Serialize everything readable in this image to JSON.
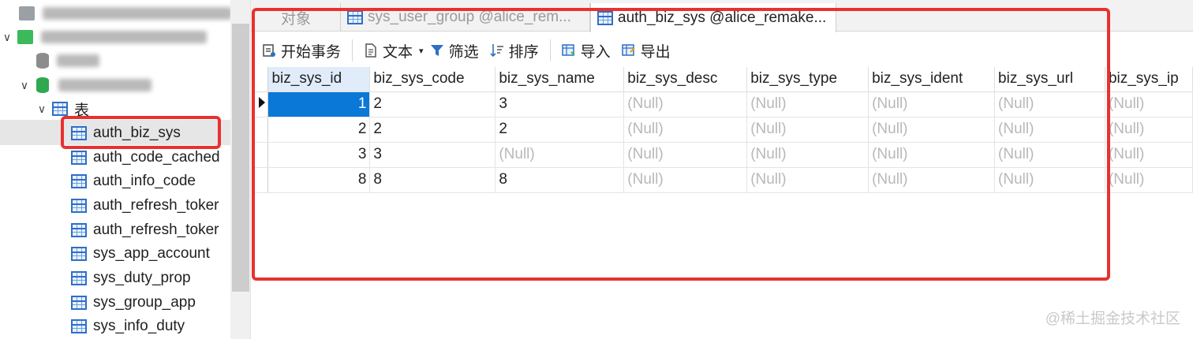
{
  "sidebar": {
    "tree": {
      "category_label": "表",
      "tables": [
        "auth_biz_sys",
        "auth_code_cached",
        "auth_info_code",
        "auth_refresh_toker",
        "auth_refresh_toker",
        "sys_app_account",
        "sys_duty_prop",
        "sys_group_app",
        "sys_info_duty"
      ],
      "selected_table": "auth_biz_sys"
    }
  },
  "tabs": [
    {
      "label": "对象",
      "active": false
    },
    {
      "label": "sys_user_group @alice_rem...",
      "active": false
    },
    {
      "label": "auth_biz_sys @alice_remake...",
      "active": true
    }
  ],
  "toolbar": {
    "begin_transaction": "开始事务",
    "text": "文本",
    "filter": "筛选",
    "sort": "排序",
    "import": "导入",
    "export": "导出"
  },
  "grid": {
    "columns": [
      "biz_sys_id",
      "biz_sys_code",
      "biz_sys_name",
      "biz_sys_desc",
      "biz_sys_type",
      "biz_sys_ident",
      "biz_sys_url",
      "biz_sys_ip"
    ],
    "rows": [
      [
        "1",
        "2",
        "3",
        "(Null)",
        "(Null)",
        "(Null)",
        "(Null)",
        "(Null)"
      ],
      [
        "2",
        "2",
        "2",
        "(Null)",
        "(Null)",
        "(Null)",
        "(Null)",
        "(Null)"
      ],
      [
        "3",
        "3",
        "(Null)",
        "(Null)",
        "(Null)",
        "(Null)",
        "(Null)",
        "(Null)"
      ],
      [
        "8",
        "8",
        "8",
        "(Null)",
        "(Null)",
        "(Null)",
        "(Null)",
        "(Null)"
      ]
    ],
    "current_row": 0,
    "selected_column": "biz_sys_id"
  },
  "watermark": "@稀土掘金技术社区",
  "colors": {
    "highlight_box": "#e8312f",
    "selection": "#0a78d7",
    "null_text": "#b8b8b8",
    "table_icon": "#2f6fc6",
    "db_icon": "#2fa84f"
  }
}
